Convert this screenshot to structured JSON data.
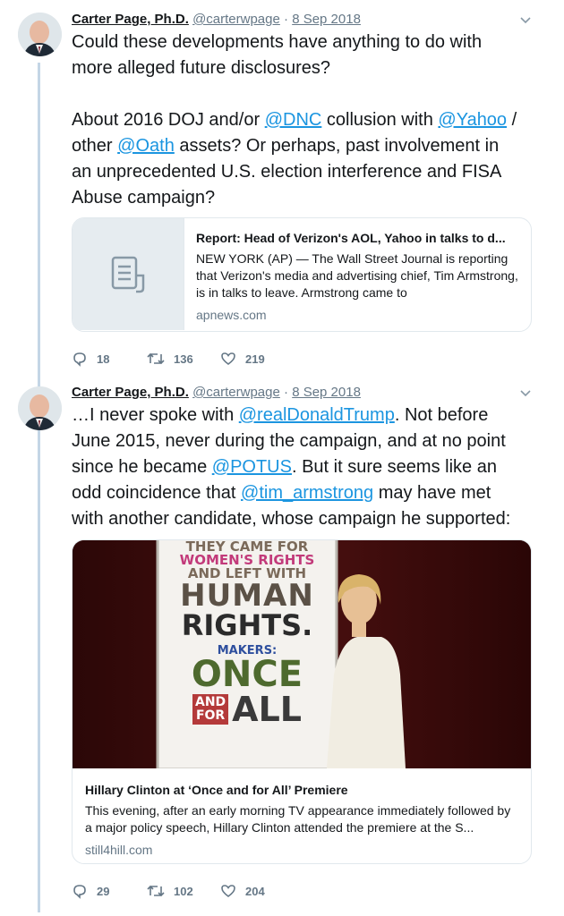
{
  "tweets": [
    {
      "author": "Carter Page, Ph.D.",
      "handle": "@carterwpage",
      "date": "8 Sep 2018",
      "text": [
        {
          "t": "Could these developments have anything to do with\nmore alleged future disclosures?\n\nAbout 2016 DOJ and/or "
        },
        {
          "m": "@DNC"
        },
        {
          "t": " collusion with "
        },
        {
          "m": "@Yahoo"
        },
        {
          "t": " /\nother "
        },
        {
          "m": "@Oath"
        },
        {
          "t": " assets? Or perhaps, past involvement in\nan unprecedented U.S. election interference and FISA\nAbuse campaign?"
        }
      ],
      "card": {
        "title": "Report: Head of Verizon's AOL, Yahoo in talks to d...",
        "description": "NEW YORK (AP) — The Wall Street Journal is reporting that Verizon's media and advertising chief, Tim Armstrong, is in talks to leave. Armstrong came to",
        "domain": "apnews.com"
      },
      "replies": "18",
      "retweets": "136",
      "likes": "219"
    },
    {
      "author": "Carter Page, Ph.D.",
      "handle": "@carterwpage",
      "date": "8 Sep 2018",
      "text": [
        {
          "t": "…I never spoke with "
        },
        {
          "m": "@realDonaldTrump"
        },
        {
          "t": ". Not before\nJune 2015, never during the campaign, and at no point\nsince he became "
        },
        {
          "m": "@POTUS"
        },
        {
          "t": ". But it sure seems like an\nodd coincidence that "
        },
        {
          "m": "@tim_armstrong"
        },
        {
          "t": " may have met\nwith another candidate, whose campaign he supported:"
        }
      ],
      "card": {
        "poster_lines": [
          "THEY CAME FOR",
          "WOMEN'S RIGHTS",
          "AND LEFT WITH",
          "HUMAN",
          "RIGHTS.",
          "MAKERS:",
          "ONCE",
          "AND",
          "FOR",
          "ALL"
        ],
        "title": "Hillary Clinton at ‘Once and for All’ Premiere",
        "description": "This evening, after an early morning TV appearance immediately followed by a major policy speech, Hillary Clinton attended the premiere at the S...",
        "domain": "still4hill.com"
      },
      "replies": "29",
      "retweets": "102",
      "likes": "204"
    }
  ],
  "colors": {
    "link": "#1b95e0",
    "muted": "#657786",
    "thread": "#c4d6e6"
  },
  "icons": [
    "avatar",
    "chevron-down-icon",
    "document-icon",
    "reply-icon",
    "retweet-icon",
    "heart-icon"
  ]
}
